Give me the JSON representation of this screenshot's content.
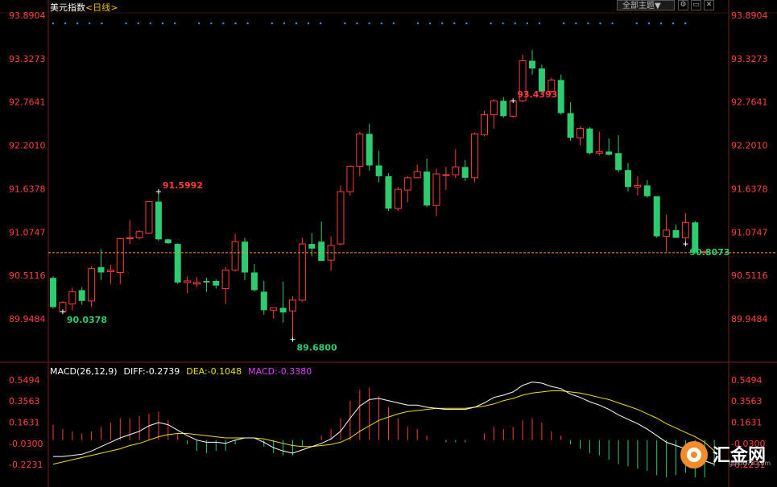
{
  "header": {
    "symbol": "美元指数",
    "period": "<日线>",
    "theme_dropdown": "全部主题▼",
    "icon_names": [
      "settings-icon",
      "minimize-icon",
      "close-icon"
    ]
  },
  "macd": {
    "label": "MACD(26,12,9)",
    "diff_text": "DIFF:-0.2739",
    "dea_text": "DEA:-0.1048",
    "macd_text": "MACD:-0.3380"
  },
  "watermark": {
    "brand": "汇金网",
    "url": "gold678.com"
  },
  "colors": {
    "up": "#ff3b3b",
    "down": "#2ecc71",
    "axis": "#ff4040",
    "diff": "#ffffff",
    "dea": "#f0e000",
    "macd": "#e040ff",
    "ref": "#ff9020",
    "dots": "#3a8fe0"
  },
  "chart_data": [
    {
      "type": "candlestick",
      "title": "美元指数<日线>",
      "y_ticks": [
        "93.8904",
        "93.3273",
        "92.7641",
        "92.2010",
        "91.6378",
        "91.0747",
        "90.5116",
        "89.9484"
      ],
      "ylim": [
        89.46,
        93.89
      ],
      "last_price": "90.8073",
      "annotations": [
        {
          "label": "93.4393",
          "kind": "high",
          "index": 48
        },
        {
          "label": "91.5992",
          "kind": "high",
          "index": 11
        },
        {
          "label": "90.0378",
          "kind": "low",
          "index": 1
        },
        {
          "label": "89.6800",
          "kind": "low",
          "index": 25
        },
        {
          "label": "90.8073",
          "kind": "low",
          "index": 66
        }
      ],
      "ohlc": [
        [
          90.48,
          90.5,
          90.08,
          90.1
        ],
        [
          90.04,
          90.18,
          90.04,
          90.16
        ],
        [
          90.14,
          90.35,
          90.06,
          90.3
        ],
        [
          90.32,
          90.36,
          90.13,
          90.18
        ],
        [
          90.18,
          90.63,
          90.1,
          90.6
        ],
        [
          90.62,
          90.85,
          90.45,
          90.55
        ],
        [
          90.56,
          90.65,
          90.4,
          90.58
        ],
        [
          90.55,
          91.0,
          90.4,
          90.99
        ],
        [
          91.0,
          91.23,
          90.92,
          91.0
        ],
        [
          91.0,
          91.1,
          90.98,
          91.08
        ],
        [
          91.06,
          91.47,
          91.05,
          91.47
        ],
        [
          91.47,
          91.6,
          90.96,
          90.98
        ],
        [
          90.98,
          90.99,
          90.92,
          90.93
        ],
        [
          90.92,
          90.93,
          90.4,
          90.42
        ],
        [
          90.42,
          90.5,
          90.28,
          90.44
        ],
        [
          90.4,
          90.49,
          90.36,
          90.42
        ],
        [
          90.44,
          90.48,
          90.3,
          90.42
        ],
        [
          90.44,
          90.46,
          90.34,
          90.38
        ],
        [
          90.34,
          90.62,
          90.14,
          90.58
        ],
        [
          90.58,
          91.05,
          90.56,
          90.95
        ],
        [
          90.95,
          91.0,
          90.45,
          90.55
        ],
        [
          90.55,
          90.66,
          90.3,
          90.32
        ],
        [
          90.3,
          90.44,
          90.0,
          90.06
        ],
        [
          90.06,
          90.08,
          89.95,
          90.09
        ],
        [
          90.09,
          90.43,
          89.9,
          90.03
        ],
        [
          90.05,
          90.24,
          89.68,
          90.19
        ],
        [
          90.19,
          91.0,
          90.17,
          90.92
        ],
        [
          90.92,
          91.06,
          90.76,
          90.86
        ],
        [
          90.95,
          91.21,
          90.73,
          90.7
        ],
        [
          90.71,
          91.02,
          90.57,
          90.9
        ],
        [
          90.92,
          91.68,
          90.9,
          91.6
        ],
        [
          91.6,
          91.94,
          91.55,
          91.93
        ],
        [
          91.93,
          92.38,
          91.8,
          92.35
        ],
        [
          92.35,
          92.48,
          91.87,
          91.94
        ],
        [
          91.94,
          92.13,
          91.72,
          91.8
        ],
        [
          91.8,
          91.84,
          91.35,
          91.38
        ],
        [
          91.38,
          91.66,
          91.35,
          91.63
        ],
        [
          91.62,
          91.8,
          91.46,
          91.78
        ],
        [
          91.78,
          91.95,
          91.8,
          91.86
        ],
        [
          91.86,
          92.03,
          91.4,
          91.42
        ],
        [
          91.42,
          91.9,
          91.28,
          91.83
        ],
        [
          91.82,
          91.92,
          91.62,
          91.82
        ],
        [
          91.82,
          92.15,
          91.78,
          91.92
        ],
        [
          91.92,
          92.01,
          91.74,
          91.78
        ],
        [
          91.78,
          92.37,
          91.72,
          92.35
        ],
        [
          92.34,
          92.65,
          92.32,
          92.6
        ],
        [
          92.6,
          92.8,
          92.42,
          92.78
        ],
        [
          92.78,
          92.83,
          92.56,
          92.58
        ],
        [
          92.58,
          92.78,
          92.56,
          92.78
        ],
        [
          92.78,
          93.38,
          92.76,
          93.3
        ],
        [
          93.3,
          93.44,
          93.12,
          93.2
        ],
        [
          93.2,
          93.25,
          92.88,
          92.9
        ],
        [
          92.9,
          93.08,
          92.88,
          93.05
        ],
        [
          93.05,
          93.12,
          92.6,
          92.62
        ],
        [
          92.62,
          92.76,
          92.26,
          92.3
        ],
        [
          92.3,
          92.45,
          92.2,
          92.42
        ],
        [
          92.42,
          92.44,
          92.08,
          92.1
        ],
        [
          92.1,
          92.38,
          92.07,
          92.12
        ],
        [
          92.12,
          92.29,
          92.07,
          92.08
        ],
        [
          92.1,
          92.33,
          91.85,
          91.88
        ],
        [
          91.88,
          91.97,
          91.6,
          91.66
        ],
        [
          91.66,
          91.8,
          91.55,
          91.68
        ],
        [
          91.68,
          91.75,
          91.52,
          91.54
        ],
        [
          91.54,
          91.36,
          91.0,
          91.02
        ],
        [
          91.02,
          91.3,
          90.82,
          91.1
        ],
        [
          91.1,
          91.17,
          91.0,
          91.0
        ],
        [
          91.0,
          91.32,
          90.92,
          91.2
        ],
        [
          91.2,
          91.22,
          90.79,
          90.81
        ],
        [
          90.81,
          90.84,
          90.8,
          90.82
        ]
      ]
    },
    {
      "type": "macd",
      "y_ticks": [
        "0.5494",
        "0.3563",
        "0.1631",
        "-0.0300",
        "-0.2231"
      ],
      "ylim": [
        -0.4,
        0.6
      ],
      "diff": [
        -0.15,
        -0.15,
        -0.14,
        -0.13,
        -0.1,
        -0.06,
        -0.02,
        0.02,
        0.05,
        0.08,
        0.13,
        0.16,
        0.14,
        0.09,
        0.04,
        0.0,
        -0.02,
        -0.02,
        -0.03,
        0.0,
        0.02,
        0.02,
        -0.02,
        -0.07,
        -0.1,
        -0.12,
        -0.09,
        -0.06,
        -0.03,
        0.01,
        0.08,
        0.2,
        0.31,
        0.37,
        0.38,
        0.36,
        0.34,
        0.32,
        0.32,
        0.3,
        0.29,
        0.28,
        0.28,
        0.28,
        0.3,
        0.34,
        0.39,
        0.41,
        0.44,
        0.5,
        0.53,
        0.52,
        0.49,
        0.47,
        0.42,
        0.39,
        0.35,
        0.32,
        0.28,
        0.23,
        0.19,
        0.15,
        0.1,
        0.04,
        -0.02,
        -0.05,
        -0.08,
        -0.14,
        -0.19,
        -0.22
      ],
      "dea": [
        -0.22,
        -0.2,
        -0.18,
        -0.16,
        -0.14,
        -0.12,
        -0.1,
        -0.08,
        -0.05,
        -0.03,
        0.0,
        0.03,
        0.05,
        0.06,
        0.06,
        0.05,
        0.04,
        0.03,
        0.02,
        0.02,
        0.02,
        0.02,
        0.01,
        -0.01,
        -0.03,
        -0.05,
        -0.06,
        -0.06,
        -0.05,
        -0.04,
        -0.02,
        0.02,
        0.08,
        0.13,
        0.18,
        0.21,
        0.24,
        0.26,
        0.27,
        0.28,
        0.29,
        0.29,
        0.29,
        0.29,
        0.3,
        0.31,
        0.33,
        0.36,
        0.38,
        0.41,
        0.43,
        0.44,
        0.45,
        0.45,
        0.44,
        0.43,
        0.41,
        0.39,
        0.37,
        0.34,
        0.31,
        0.28,
        0.24,
        0.2,
        0.15,
        0.11,
        0.07,
        0.03,
        -0.02,
        -0.1
      ],
      "macd": [
        0.14,
        0.1,
        0.08,
        0.06,
        0.08,
        0.12,
        0.16,
        0.2,
        0.2,
        0.22,
        0.24,
        0.26,
        0.18,
        0.06,
        -0.04,
        -0.1,
        -0.12,
        -0.1,
        -0.1,
        -0.04,
        0.0,
        0.0,
        -0.06,
        -0.12,
        -0.14,
        -0.14,
        -0.06,
        0.0,
        0.04,
        0.1,
        0.2,
        0.36,
        0.46,
        0.48,
        0.4,
        0.3,
        0.2,
        0.12,
        0.1,
        0.04,
        0.0,
        -0.02,
        -0.02,
        -0.02,
        0.0,
        0.06,
        0.12,
        0.1,
        0.12,
        0.18,
        0.2,
        0.16,
        0.08,
        0.04,
        -0.04,
        -0.08,
        -0.12,
        -0.14,
        -0.18,
        -0.22,
        -0.24,
        -0.26,
        -0.28,
        -0.32,
        -0.34,
        -0.32,
        -0.3,
        -0.34,
        -0.34,
        -0.24
      ]
    }
  ]
}
